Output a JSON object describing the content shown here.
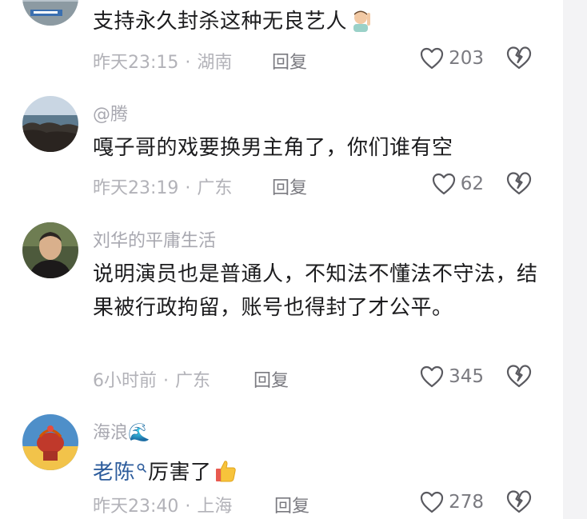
{
  "comments": [
    {
      "username": "",
      "content": "支持永久封杀这种无良艺人",
      "emoji": "man-raising-hand-emoji",
      "time": "昨天23:15",
      "location": "湖南",
      "reply_label": "回复",
      "likes": "203"
    },
    {
      "username": "@腾",
      "content": "嘎子哥的戏要换男主角了，你们谁有空",
      "time": "昨天23:19",
      "location": "广东",
      "reply_label": "回复",
      "likes": "62"
    },
    {
      "username": "刘华的平庸生活",
      "content": "说明演员也是普通人，不知法不懂法不守法，结果被行政拘留，账号也得封了才公平。",
      "time": "6小时前",
      "location": "广东",
      "reply_label": "回复",
      "likes": "345"
    },
    {
      "username": "海浪🌊",
      "mention": "老陈",
      "content": "厉害了",
      "emoji": "thumbs-up-emoji",
      "time": "昨天23:40",
      "location": "上海",
      "reply_label": "回复",
      "likes": "278"
    }
  ],
  "separator": "·",
  "colors": {
    "mention": "#2d5c9c",
    "meta": "#b2b2b8",
    "text": "#1c1c1e"
  }
}
